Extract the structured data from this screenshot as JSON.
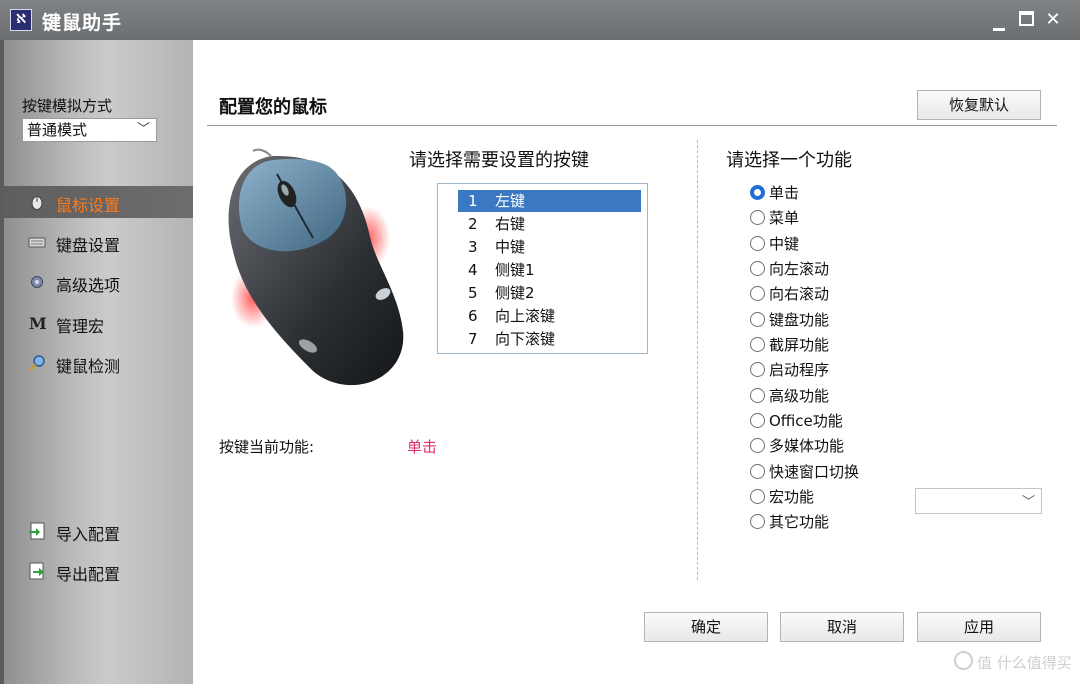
{
  "window": {
    "title": "键鼠助手",
    "app_icon": "ℵ"
  },
  "sidebar": {
    "sim_label": "按键模拟方式",
    "sim_select_value": "普通模式",
    "items": [
      {
        "label": "鼠标设置",
        "icon": "mouse-icon",
        "active": true
      },
      {
        "label": "键盘设置",
        "icon": "keyboard-icon",
        "active": false
      },
      {
        "label": "高级选项",
        "icon": "gear-icon",
        "active": false
      },
      {
        "label": "管理宏",
        "icon": "macro-m-icon",
        "active": false
      },
      {
        "label": "键鼠检测",
        "icon": "magnifier-icon",
        "active": false
      },
      {
        "label": "导入配置",
        "icon": "import-icon",
        "active": false
      },
      {
        "label": "导出配置",
        "icon": "export-icon",
        "active": false
      }
    ]
  },
  "main": {
    "title": "配置您的鼠标",
    "restore_button": "恢复默认",
    "select_key_title": "请选择需要设置的按键",
    "keys": [
      {
        "num": "1",
        "name": "左键",
        "selected": true
      },
      {
        "num": "2",
        "name": "右键",
        "selected": false
      },
      {
        "num": "3",
        "name": "中键",
        "selected": false
      },
      {
        "num": "4",
        "name": "侧键1",
        "selected": false
      },
      {
        "num": "5",
        "name": "侧键2",
        "selected": false
      },
      {
        "num": "6",
        "name": "向上滚键",
        "selected": false
      },
      {
        "num": "7",
        "name": "向下滚键",
        "selected": false
      }
    ],
    "current_function_label": "按键当前功能:",
    "current_function_value": "单击",
    "select_function_title": "请选择一个功能",
    "functions": [
      {
        "label": "单击",
        "checked": true
      },
      {
        "label": "菜单",
        "checked": false
      },
      {
        "label": "中键",
        "checked": false
      },
      {
        "label": "向左滚动",
        "checked": false
      },
      {
        "label": "向右滚动",
        "checked": false
      },
      {
        "label": "键盘功能",
        "checked": false
      },
      {
        "label": "截屏功能",
        "checked": false
      },
      {
        "label": "启动程序",
        "checked": false
      },
      {
        "label": "高级功能",
        "checked": false
      },
      {
        "label": "Office功能",
        "checked": false
      },
      {
        "label": "多媒体功能",
        "checked": false
      },
      {
        "label": "快速窗口切换",
        "checked": false
      },
      {
        "label": "宏功能",
        "checked": false
      },
      {
        "label": "其它功能",
        "checked": false
      }
    ],
    "macro_select_value": "",
    "ok_button": "确定",
    "cancel_button": "取消",
    "apply_button": "应用"
  },
  "watermark": "值 什么值得买",
  "colors": {
    "active_nav_text": "#ff7a1a",
    "selection_blue": "#3a78c3",
    "current_function_red": "#e0306a",
    "radio_checked": "#1e6ed6"
  }
}
